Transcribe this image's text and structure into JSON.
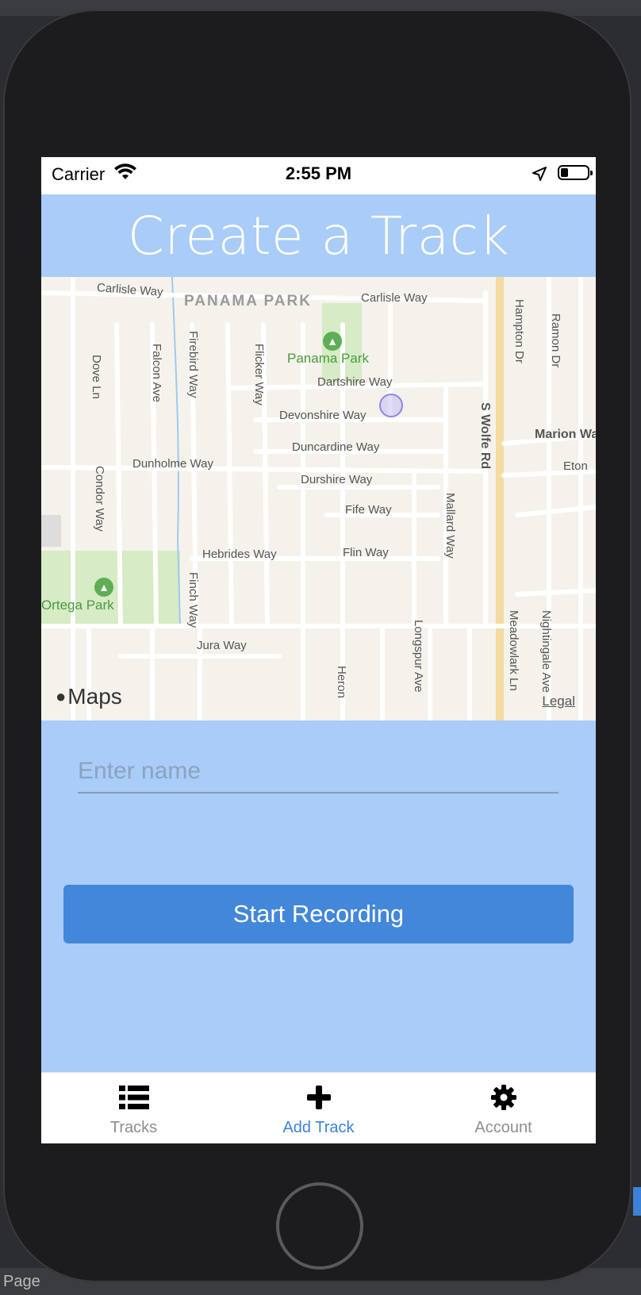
{
  "status_bar": {
    "carrier": "Carrier",
    "time": "2:55 PM"
  },
  "header": {
    "title": "Create a Track"
  },
  "map": {
    "district_label": "PANAMA PARK",
    "park_labels": [
      "Panama Park",
      "Ortega Park"
    ],
    "street_labels": [
      "Carlisle Way",
      "Carlisle Way",
      "Dartshire Way",
      "Devonshire Way",
      "Duncardine Way",
      "Dunholme Way",
      "Durshire Way",
      "Fife Way",
      "Hebrides Way",
      "Flin Way",
      "Jura Way",
      "Dove Ln",
      "Falcon Ave",
      "Firebird Way",
      "Flicker Way",
      "Condor Way",
      "Finch Way",
      "Mallard Way",
      "Longspur Ave",
      "Heron",
      "Hampton Dr",
      "Ramon Dr",
      "Meadowlark Ln",
      "Nightingale Ave",
      "Marion Wa",
      "Eton"
    ],
    "major_road": "S Wolfe Rd",
    "attribution": "Maps",
    "legal": "Legal"
  },
  "form": {
    "name_placeholder": "Enter name",
    "name_value": "",
    "record_label": "Start Recording"
  },
  "tab_bar": {
    "tabs": [
      {
        "label": "Tracks",
        "icon": "list-icon",
        "active": false
      },
      {
        "label": "Add Track",
        "icon": "plus-icon",
        "active": true
      },
      {
        "label": "Account",
        "icon": "gear-icon",
        "active": false
      }
    ]
  },
  "colors": {
    "background": "#a9ccf8",
    "button": "#4387da",
    "active_tab": "#3b82d6",
    "inactive_tab": "#8e8e93"
  },
  "footer": {
    "text": "Page"
  }
}
